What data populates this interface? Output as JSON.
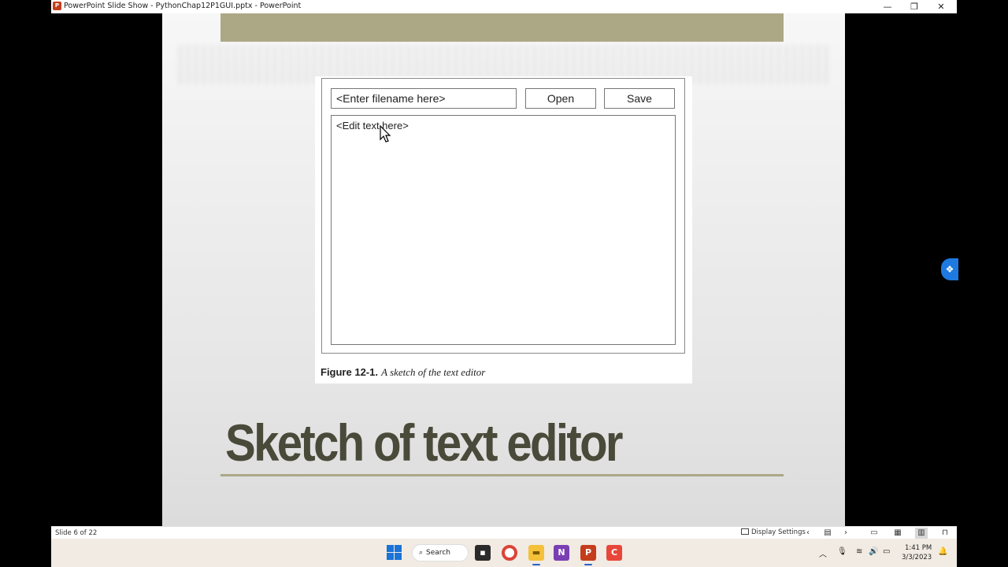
{
  "window": {
    "title": "PowerPoint Slide Show  -  PythonChap12P1GUI.pptx - PowerPoint",
    "app_icon": "P",
    "controls": {
      "minimize": "—",
      "restore": "❐",
      "close": "✕"
    }
  },
  "slide": {
    "title": "Sketch of text editor",
    "accent_color": "#aca886",
    "figure": {
      "filename_placeholder": "<Enter filename here>",
      "open_label": "Open",
      "save_label": "Save",
      "text_placeholder": "<Edit text here>",
      "caption_number": "Figure 12-1.",
      "caption_text": "A sketch of the text editor"
    }
  },
  "status_bar": {
    "slide_counter": "Slide 6 of 22",
    "display_settings": "Display Settings",
    "icons": [
      "chevron-left-icon",
      "notes-icon",
      "chevron-right-icon",
      "normal-view-icon",
      "slide-sorter-icon",
      "reading-view-icon",
      "slideshow-icon"
    ]
  },
  "taskbar": {
    "search_label": "Search",
    "apps": [
      "start-icon",
      "search",
      "file-icon",
      "chrome-icon",
      "file-explorer-icon",
      "onenote-icon",
      "powerpoint-icon",
      "camtasia-icon"
    ],
    "clock_time": "1:41 PM",
    "clock_date": "3/3/2023"
  }
}
